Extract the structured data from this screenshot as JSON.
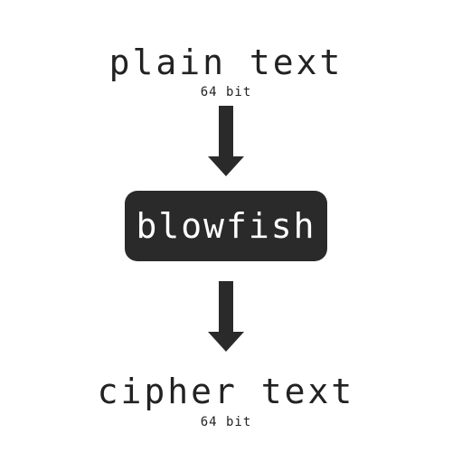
{
  "diagram": {
    "input": {
      "label": "plain text",
      "size": "64 bit"
    },
    "cipher": {
      "label": "blowfish"
    },
    "output": {
      "label": "cipher text",
      "size": "64 bit"
    },
    "colors": {
      "background": "#ffffff",
      "text": "#222222",
      "box_fill": "#2a2a2a",
      "box_text": "#ffffff",
      "arrow": "#2a2a2a"
    },
    "icons": [
      "arrow-down-icon",
      "arrow-down-icon"
    ]
  }
}
